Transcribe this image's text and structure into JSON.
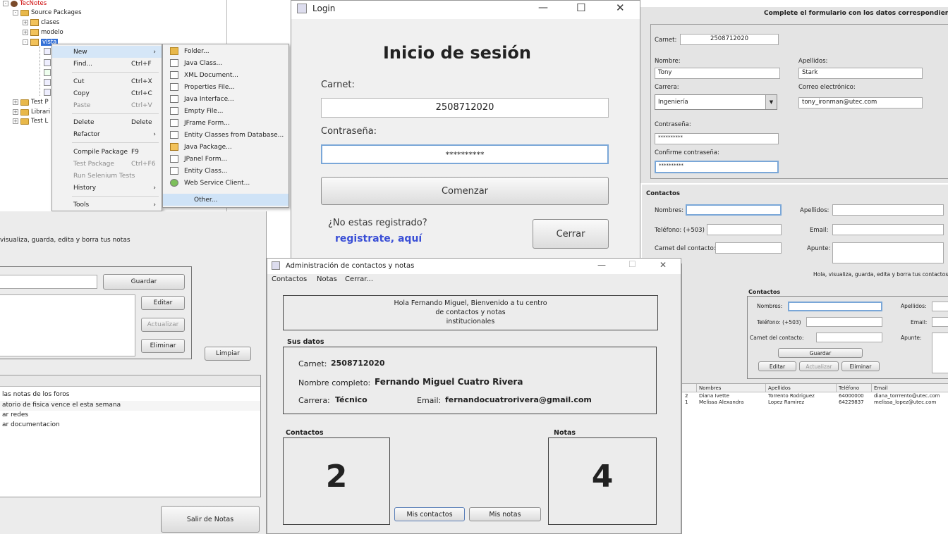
{
  "netbeans": {
    "tree": [
      {
        "label": "TecNotes",
        "level": 0
      },
      {
        "label": "Source Packages",
        "level": 1
      },
      {
        "label": "clases",
        "level": 2
      },
      {
        "label": "modelo",
        "level": 2
      },
      {
        "label": "vista",
        "level": 2
      },
      {
        "label": "Test P",
        "level": 0
      },
      {
        "label": "Librari",
        "level": 0
      },
      {
        "label": "Test L",
        "level": 0
      }
    ],
    "context_menu": [
      {
        "label": "New",
        "key": "",
        "arrow": "›",
        "disabled": false,
        "selected": true
      },
      {
        "label": "Find...",
        "key": "Ctrl+F",
        "arrow": "",
        "disabled": false
      },
      {
        "label": "Cut",
        "key": "Ctrl+X",
        "arrow": "",
        "disabled": false
      },
      {
        "label": "Copy",
        "key": "Ctrl+C",
        "arrow": "",
        "disabled": false
      },
      {
        "label": "Paste",
        "key": "Ctrl+V",
        "arrow": "",
        "disabled": true
      },
      {
        "label": "Delete",
        "key": "Delete",
        "arrow": "",
        "disabled": false
      },
      {
        "label": "Refactor",
        "key": "",
        "arrow": "›",
        "disabled": false
      },
      {
        "label": "Compile Package",
        "key": "F9",
        "arrow": "",
        "disabled": false
      },
      {
        "label": "Test Package",
        "key": "Ctrl+F6",
        "arrow": "",
        "disabled": true
      },
      {
        "label": "Run Selenium Tests",
        "key": "",
        "arrow": "",
        "disabled": true
      },
      {
        "label": "History",
        "key": "",
        "arrow": "›",
        "disabled": false
      },
      {
        "label": "Tools",
        "key": "",
        "arrow": "›",
        "disabled": false
      }
    ],
    "submenu": [
      "Folder...",
      "Java Class...",
      "XML Document...",
      "Properties File...",
      "Java Interface...",
      "Empty File...",
      "JFrame Form...",
      "Entity Classes from Database...",
      "Java Package...",
      "JPanel Form...",
      "Entity Class...",
      "Web Service Client...",
      "Other..."
    ]
  },
  "login": {
    "title": "Login",
    "heading": "Inicio de sesión",
    "carnet_label": "Carnet:",
    "carnet_value": "2508712020",
    "password_label": "Contraseña:",
    "password_value": "**********",
    "start_button": "Comenzar",
    "not_registered": "¿No estas registrado?",
    "register_link": "registrate, aquí",
    "close_button": "Cerrar",
    "window_controls": {
      "minimize": "—",
      "maximize": "☐",
      "close": "✕"
    }
  },
  "registro": {
    "heading": "Complete el formulario con los datos correspondientes",
    "carnet_label": "Carnet:",
    "carnet_value": "2508712020",
    "nombre_label": "Nombre:",
    "nombre_value": "Tony",
    "apellidos_label": "Apellidos:",
    "apellidos_value": "Stark",
    "carrera_label": "Carrera:",
    "carrera_value": "Ingeniería",
    "correo_label": "Correo electrónico:",
    "correo_value": "tony_ironman@utec.com",
    "pass_label": "Contraseña:",
    "pass_value": "**********",
    "confirm_label": "Confirme contraseña:",
    "confirm_value": "**********"
  },
  "contactos_top": {
    "section": "Contactos",
    "nombres_label": "Nombres:",
    "apellidos_label": "Apellidos:",
    "telefono_label": "Teléfono: (+503)",
    "email_label": "Email:",
    "carnet_label": "Carnet del contacto:",
    "apunte_label": "Apunte:"
  },
  "notas": {
    "subtitle": "visualiza, guarda, edita y borra tus notas",
    "guardar": "Guardar",
    "editar": "Editar",
    "actualizar": "Actualizar",
    "eliminar": "Eliminar",
    "limpiar": "Limpiar",
    "list": [
      "las notas de los foros",
      "atorio de fisica vence el esta semana",
      "ar redes",
      "ar documentacion"
    ],
    "salir": "Salir de Notas"
  },
  "admin": {
    "title": "Administración de contactos y notas",
    "menu": [
      "Contactos",
      "Notas",
      "Cerrar..."
    ],
    "welcome_line1": "Hola Fernando Miguel, Bienvenido a tu centro",
    "welcome_line2": "de contactos y notas",
    "welcome_line3": "institucionales",
    "sus_datos": "Sus datos",
    "carnet_label": "Carnet:",
    "carnet_value": "2508712020",
    "nombre_label": "Nombre completo:",
    "nombre_value": "Fernando Miguel Cuatro Rivera",
    "carrera_label": "Carrera:",
    "carrera_value": "Técnico",
    "email_label": "Email:",
    "email_value": "fernandocuatrorivera@gmail.com",
    "contactos_label": "Contactos",
    "contactos_count": "2",
    "notas_label": "Notas",
    "notas_count": "4",
    "mis_contactos": "Mis contactos",
    "mis_notas": "Mis notas",
    "controls": {
      "minimize": "—",
      "maximize": "☐",
      "close": "✕"
    }
  },
  "contactos_win": {
    "greeting": "Hola, visualiza, guarda, edita y borra tus contactos",
    "section": "Contactos",
    "nombres_label": "Nombres:",
    "apellidos_label": "Apellidos:",
    "telefono_label": "Teléfono: (+503)",
    "email_label": "Email:",
    "carnet_label": "Carnet del contacto:",
    "apunte_label": "Apunte:",
    "guardar": "Guardar",
    "editar": "Editar",
    "actualizar": "Actualizar",
    "eliminar": "Eliminar",
    "columns": [
      "",
      "Nombres",
      "Apellidos",
      "Teléfono",
      "Email"
    ],
    "rows": [
      [
        "2",
        "Diana Ivette",
        "Torrento Rodriguez",
        "64000000",
        "diana_torrrento@utec.com"
      ],
      [
        "1",
        "Melissa Alexandra",
        "Lopez Ramirez",
        "64229837",
        "melissa_lopez@utec.com"
      ]
    ]
  }
}
